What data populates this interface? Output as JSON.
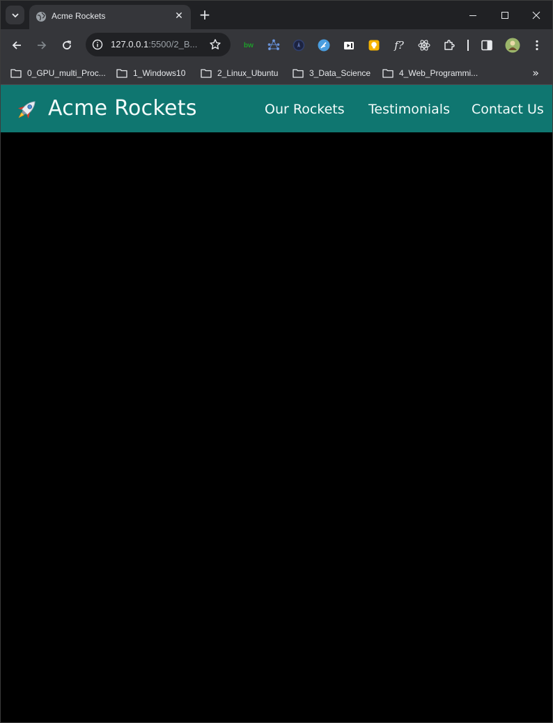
{
  "browser": {
    "tab_title": "Acme Rockets",
    "tab_close": "✕",
    "new_tab": "+",
    "url_host": "127.0.0.1",
    "url_path": ":5500/2_B...",
    "bookmarks": [
      {
        "label": "0_GPU_multi_Proc..."
      },
      {
        "label": "1_Windows10"
      },
      {
        "label": "2_Linux_Ubuntu"
      },
      {
        "label": "3_Data_Science"
      },
      {
        "label": "4_Web_Programmi..."
      }
    ],
    "bookmarks_more": "»",
    "extensions": [
      "bw-icon",
      "network-icon",
      "compass-icon",
      "feather-icon",
      "video-icon",
      "lightbulb-icon",
      "function-icon",
      "react-icon",
      "puzzle-icon"
    ],
    "ext_bw_text": "bw",
    "ext_function_text": "f?"
  },
  "site": {
    "title": "Acme Rockets",
    "nav": [
      "Our Rockets",
      "Testimonials",
      "Contact Us"
    ],
    "header_color": "#0f7670",
    "body_color": "#000000"
  }
}
